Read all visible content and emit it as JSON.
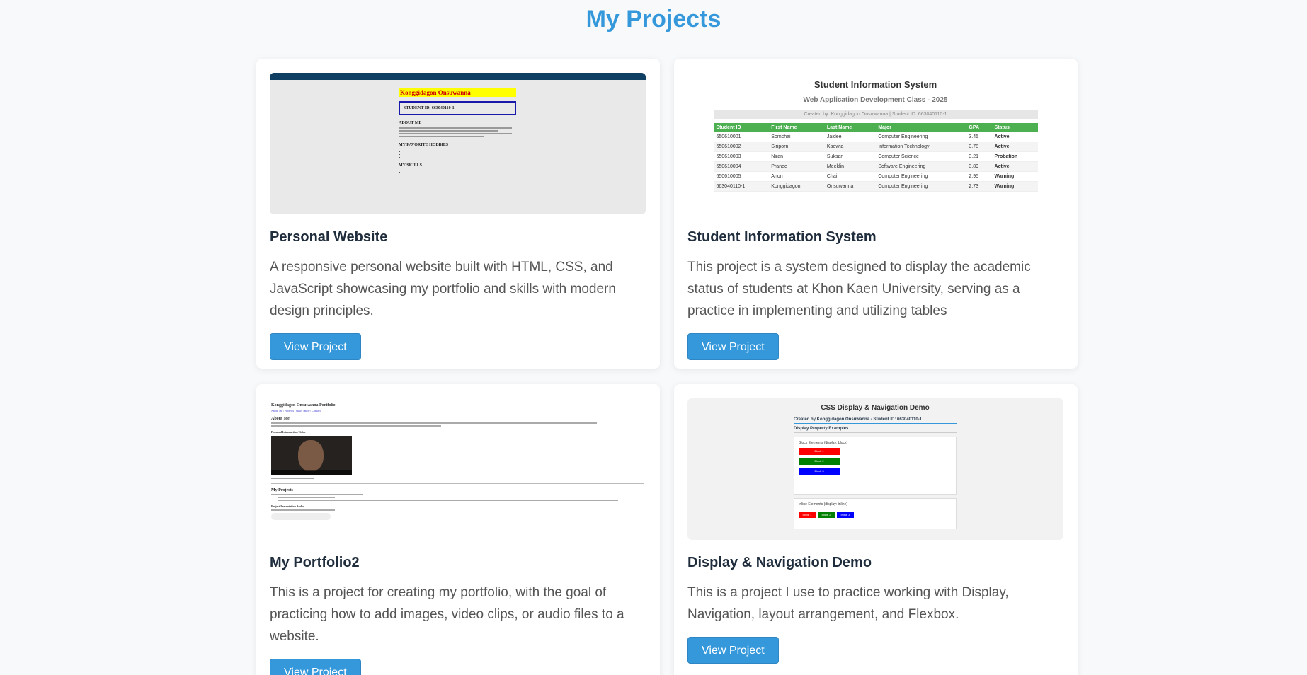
{
  "page": {
    "title": "My Projects"
  },
  "colors": {
    "accent": "#3498db",
    "background": "#f7f9fb",
    "card": "#ffffff"
  },
  "projects": [
    {
      "title": "Personal Website",
      "description": "A responsive personal website built with HTML, CSS, and JavaScript showcasing my portfolio and skills with modern design principles.",
      "button": "View Project",
      "thumb": {
        "name": "Konggidagon Onsuwanna",
        "student_id": "STUDENT ID: 663040110-1",
        "about": "ABOUT ME",
        "hobbies": "MY FAVORITE HOBBIES",
        "skills": "MY SKILLS"
      }
    },
    {
      "title": "Student Information System",
      "description": "This project is a system designed to display the academic status of students at Khon Kaen University, serving as a practice in implementing and utilizing tables",
      "button": "View Project",
      "thumb": {
        "heading": "Student Information System",
        "subheading": "Web Application Development Class - 2025",
        "creator": "Created by: Konggidagon Onsuwanna | Student ID: 663040110-1",
        "columns": [
          "Student ID",
          "First Name",
          "Last Name",
          "Major",
          "GPA",
          "Status"
        ],
        "rows": [
          [
            "650610001",
            "Somchai",
            "Jaidee",
            "Computer Engineering",
            "3.45",
            "Active"
          ],
          [
            "650610002",
            "Siriporn",
            "Kaewta",
            "Information Technology",
            "3.78",
            "Active"
          ],
          [
            "650610003",
            "Niran",
            "Suksan",
            "Computer Science",
            "3.21",
            "Probation"
          ],
          [
            "650610004",
            "Pranee",
            "Meeklin",
            "Software Engineering",
            "3.89",
            "Active"
          ],
          [
            "650610005",
            "Anon",
            "Chai",
            "Computer Engineering",
            "2.95",
            "Warning"
          ],
          [
            "663040110-1",
            "Konggidagon",
            "Onsuwanna",
            "Computer Engineering",
            "2.73",
            "Warning"
          ]
        ]
      }
    },
    {
      "title": "My Portfolio2",
      "description": "This is a project for creating my portfolio, with the goal of practicing how to add images, video clips, or audio files to a website.",
      "button": "View Project",
      "thumb": {
        "heading": "Konggidagon Onsuwanna Portfolio",
        "links": "About Me | Projects | Skills | Blog | Contact",
        "about": "About Me",
        "video_label": "Personal Introduction Video",
        "projects": "My Projects",
        "audio_label": "Project Presentation Audio"
      }
    },
    {
      "title": "Display & Navigation Demo",
      "description": "This is a project I use to practice working with Display, Navigation, layout arrangement, and Flexbox.",
      "button": "View Project",
      "thumb": {
        "heading": "CSS Display & Navigation Demo",
        "creator": "Created by Konggidagon Onsuwanna - Student ID: 663040110-1",
        "section": "Display Property Examples",
        "block_label": "Block Elements (display: block)",
        "blocks": [
          "Block 1",
          "Block 2",
          "Block 3"
        ],
        "inline_label": "Inline Elements (display: inline)",
        "inlines": [
          "Inline 1",
          "Inline 2",
          "Inline 3"
        ]
      }
    }
  ]
}
